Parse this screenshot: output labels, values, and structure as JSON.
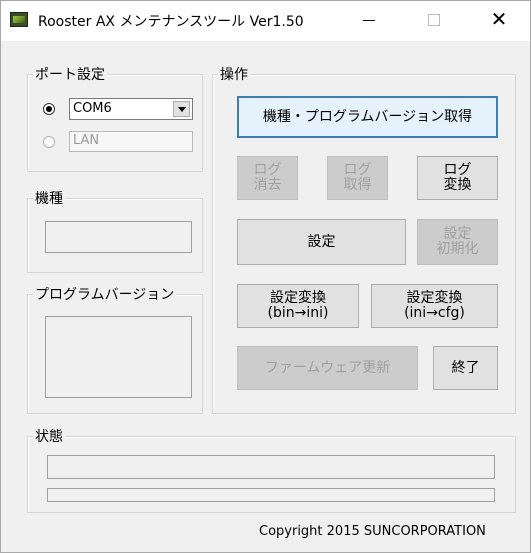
{
  "window": {
    "title": "Rooster AX メンテナンスツール Ver1.50",
    "min_glyph": "—",
    "close_glyph": "✕"
  },
  "port": {
    "title": "ポート設定",
    "com_value": "COM6",
    "lan_value": "LAN",
    "selected": "COM"
  },
  "model": {
    "title": "機種",
    "value": ""
  },
  "program_version": {
    "title": "プログラムバージョン",
    "value": ""
  },
  "operations": {
    "title": "操作",
    "get_model_version": "機種・プログラムバージョン取得",
    "log_clear": "ログ\n消去",
    "log_get": "ログ\n取得",
    "log_convert": "ログ\n変換",
    "settings": "設定",
    "settings_init": "設定\n初期化",
    "convert_bin_ini": "設定変換\n(bin→ini)",
    "convert_ini_cfg": "設定変換\n(ini→cfg)",
    "firmware_update": "ファームウェア更新",
    "exit": "終了"
  },
  "status": {
    "title": "状態",
    "line1": "",
    "line2": ""
  },
  "footer": {
    "copyright": "Copyright 2015 SUNCORPORATION"
  },
  "colors": {
    "primary_border": "#3c7fb1",
    "disabled_text": "#a0a0a0"
  },
  "icons": {
    "app": "rooster-app-icon"
  }
}
